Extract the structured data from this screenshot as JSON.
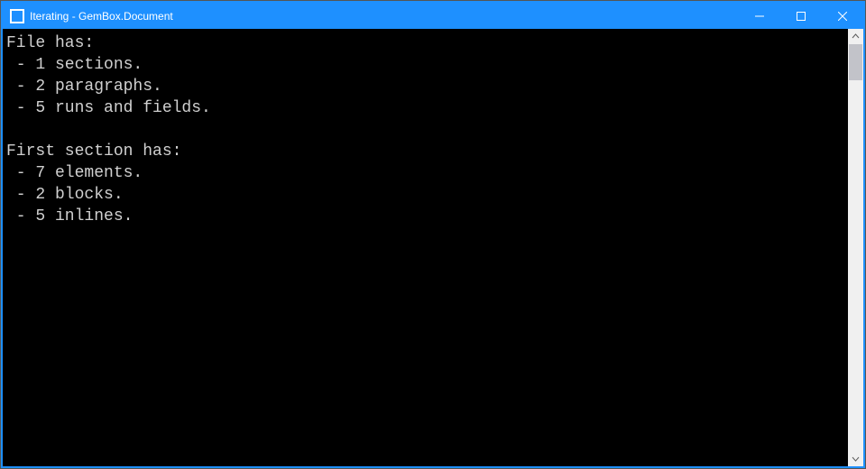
{
  "window": {
    "title": "Iterating - GemBox.Document"
  },
  "console": {
    "lines": [
      "File has:",
      " - 1 sections.",
      " - 2 paragraphs.",
      " - 5 runs and fields.",
      "",
      "First section has:",
      " - 7 elements.",
      " - 2 blocks.",
      " - 5 inlines."
    ]
  }
}
